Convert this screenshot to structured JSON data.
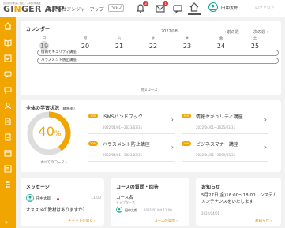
{
  "header": {
    "logo_tagline": "目の前の未来に挑む、人材の成長を",
    "logo_prefix": "GI",
    "logo_accent": "N",
    "logo_suffix": "GER APP",
    "company": "株式会社ジンジャーアップ",
    "help_label": "ヘルプ",
    "notification_count": "3",
    "message_count": "1",
    "user_name": "田中太郎",
    "logout_label": "ログアウト"
  },
  "calendar": {
    "title": "カレンダー",
    "month": "2022/08",
    "prev_week": "前の週",
    "next_week": "次の週",
    "days": [
      {
        "label": "日",
        "num": "19"
      },
      {
        "label": "月",
        "num": "20"
      },
      {
        "label": "火",
        "num": "21"
      },
      {
        "label": "水",
        "num": "22"
      },
      {
        "label": "木",
        "num": "23"
      },
      {
        "label": "金",
        "num": "24"
      },
      {
        "label": "土",
        "num": "25"
      }
    ],
    "events": [
      "情報セキュリティ講座",
      "ハラスメント防止講座"
    ],
    "footer": "他1コース"
  },
  "learning": {
    "title": "全体の学習状況",
    "title_note": "（職務率）",
    "percent": "40",
    "percent_unit": "%",
    "progress": 0.4,
    "all_courses": "すべてのコース",
    "courses": [
      {
        "pct": "70%",
        "name": "ISMSハンドブック",
        "date": "2022/04/01～2023/03/31"
      },
      {
        "pct": "70%",
        "name": "情報セキュリティ講座",
        "date": "2022/04/01～2025/03/31"
      },
      {
        "pct": "20%",
        "name": "ハラスメント防止講座",
        "date": "2022/04/01～2023/03/31"
      },
      {
        "pct": "10%",
        "name": "ビジネスマナー講座",
        "date": "2022/04/01～2099/03/31"
      }
    ]
  },
  "messages": {
    "title": "メッセージ",
    "sender": "田中太郎",
    "time": "11:00",
    "body": "オススメの教材はありますか？",
    "action": "チャットを開く"
  },
  "qa": {
    "title": "コースの質問・回答",
    "course_name": "コース名",
    "chapter": "チャプター名",
    "sender": "田中太郎",
    "datetime": "2021/01/04 11:00",
    "action": "コースの質問"
  },
  "notice": {
    "title": "お知らせ",
    "body": "5月27日(金)16:00～18:00　システムメンテナンスをいたします",
    "date": "2022/04/01",
    "action": "お知らせ"
  },
  "colors": {
    "accent": "#f0a500",
    "teal": "#19a69a"
  }
}
